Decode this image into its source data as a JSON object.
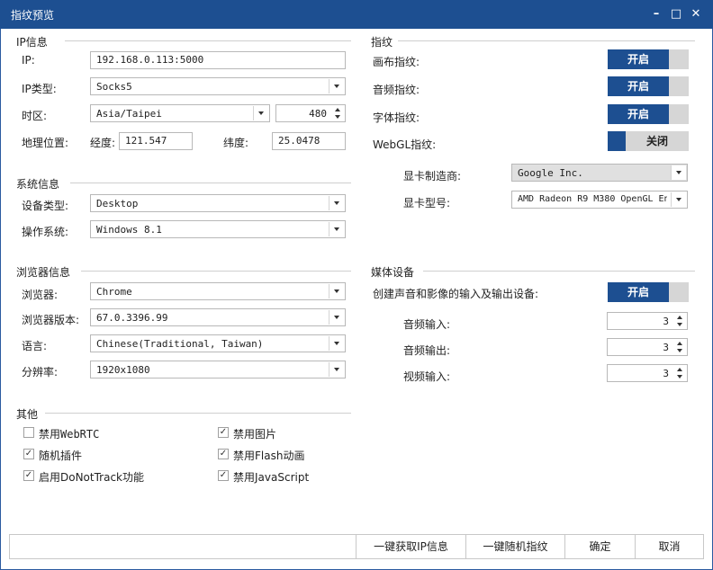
{
  "window": {
    "title": "指纹预览",
    "minimize": "–",
    "maximize": "□",
    "close": "✕"
  },
  "ip_section": {
    "header": "IP信息",
    "ip_label": "IP:",
    "ip_value": "192.168.0.113:5000",
    "type_label": "IP类型:",
    "type_value": "Socks5",
    "tz_label": "时区:",
    "tz_value": "Asia/Taipei",
    "tz_offset": "480",
    "geo_label": "地理位置:",
    "lon_label": "经度:",
    "lon_value": "121.547",
    "lat_label": "纬度:",
    "lat_value": "25.0478"
  },
  "system_section": {
    "header": "系统信息",
    "device_label": "设备类型:",
    "device_value": "Desktop",
    "os_label": "操作系统:",
    "os_value": "Windows 8.1"
  },
  "browser_section": {
    "header": "浏览器信息",
    "browser_label": "浏览器:",
    "browser_value": "Chrome",
    "version_label": "浏览器版本:",
    "version_value": "67.0.3396.99",
    "lang_label": "语言:",
    "lang_value": "Chinese(Traditional, Taiwan)",
    "res_label": "分辨率:",
    "res_value": "1920x1080"
  },
  "other_section": {
    "header": "其他",
    "checkboxes": [
      {
        "label": "禁用WebRTC",
        "checked": false
      },
      {
        "label": "随机插件",
        "checked": true
      },
      {
        "label": "启用DoNotTrack功能",
        "checked": true
      },
      {
        "label": "禁用图片",
        "checked": true
      },
      {
        "label": "禁用Flash动画",
        "checked": true
      },
      {
        "label": "禁用JavaScript",
        "checked": true
      }
    ]
  },
  "fingerprint_section": {
    "header": "指纹",
    "canvas_label": "画布指纹:",
    "canvas_state": "开启",
    "audio_label": "音频指纹:",
    "audio_state": "开启",
    "font_label": "字体指纹:",
    "font_state": "开启",
    "webgl_label": "WebGL指纹:",
    "webgl_state": "关闭",
    "vendor_label": "显卡制造商:",
    "vendor_value": "Google Inc.",
    "model_label": "显卡型号:",
    "model_value": "AMD Radeon R9 M380 OpenGL En"
  },
  "media_section": {
    "header": "媒体设备",
    "create_label": "创建声音和影像的输入及输出设备:",
    "create_state": "开启",
    "audio_in_label": "音频输入:",
    "audio_in_value": "3",
    "audio_out_label": "音频输出:",
    "audio_out_value": "3",
    "video_in_label": "视频输入:",
    "video_in_value": "3"
  },
  "buttons": {
    "get_ip": "一键获取IP信息",
    "random_fp": "一键随机指纹",
    "ok": "确定",
    "cancel": "取消"
  },
  "colors": {
    "accent": "#1d4f91",
    "toggle_off": "#d6d6d6"
  }
}
